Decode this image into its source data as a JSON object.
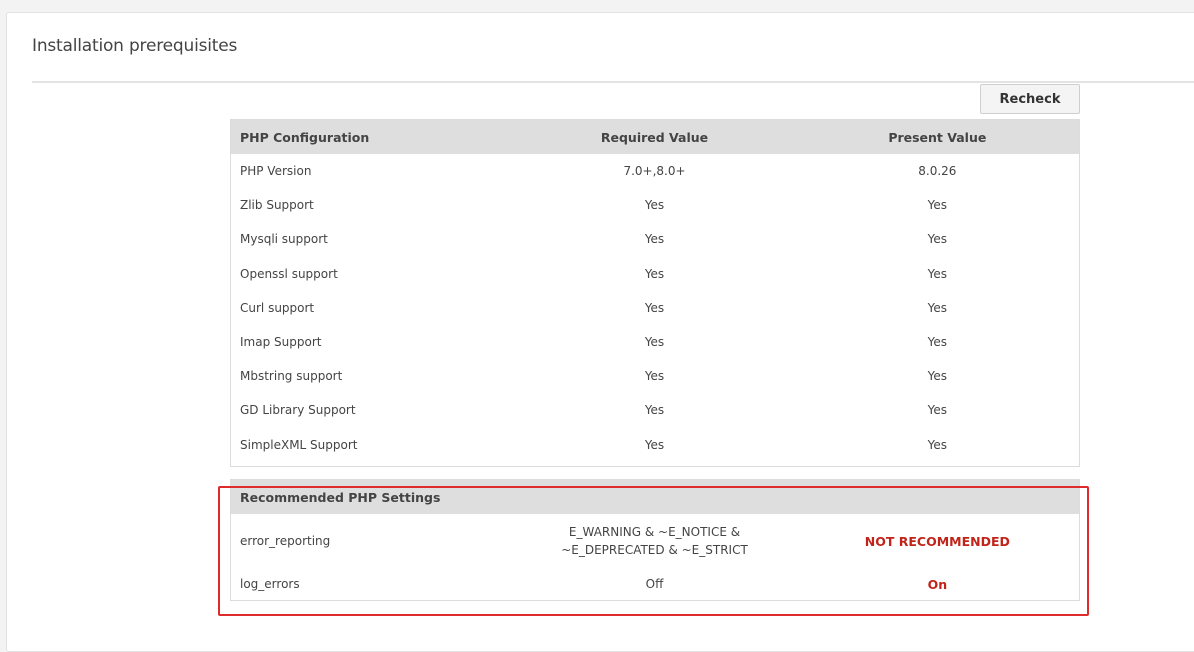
{
  "header": {
    "title": "Installation prerequisites"
  },
  "toolbar": {
    "recheck_label": "Recheck"
  },
  "php_config": {
    "columns": [
      "PHP Configuration",
      "Required Value",
      "Present Value"
    ],
    "rows": [
      [
        "PHP Version",
        "7.0+,8.0+",
        "8.0.26"
      ],
      [
        "Zlib Support",
        "Yes",
        "Yes"
      ],
      [
        "Mysqli support",
        "Yes",
        "Yes"
      ],
      [
        "Openssl support",
        "Yes",
        "Yes"
      ],
      [
        "Curl support",
        "Yes",
        "Yes"
      ],
      [
        "Imap Support",
        "Yes",
        "Yes"
      ],
      [
        "Mbstring support",
        "Yes",
        "Yes"
      ],
      [
        "GD Library Support",
        "Yes",
        "Yes"
      ],
      [
        "SimpleXML Support",
        "Yes",
        "Yes"
      ]
    ]
  },
  "recommended": {
    "title": "Recommended PHP Settings",
    "rows": [
      {
        "name": "error_reporting",
        "required_line1": "E_WARNING & ~E_NOTICE &",
        "required_line2": "~E_DEPRECATED & ~E_STRICT",
        "present": "NOT RECOMMENDED"
      },
      {
        "name": "log_errors",
        "required": "Off",
        "present": "On"
      }
    ]
  },
  "colors": {
    "warning_text": "#c0241a",
    "highlight_border": "#e02b2b",
    "table_header_bg": "#dedede"
  }
}
